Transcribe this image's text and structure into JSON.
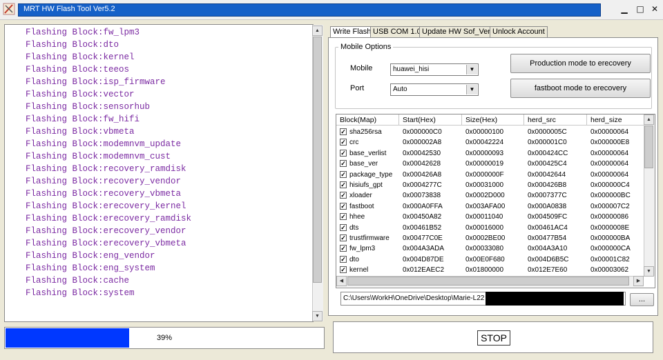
{
  "window": {
    "title": "MRT HW Flash Tool Ver5.2",
    "minimize_icon": "minimize-icon",
    "maximize_icon": "maximize-icon",
    "close_icon": "close-icon"
  },
  "log": {
    "lines": [
      "Flashing Block:fw_lpm3",
      "Flashing Block:dto",
      "Flashing Block:kernel",
      "Flashing Block:teeos",
      "Flashing Block:isp_firmware",
      "Flashing Block:vector",
      "Flashing Block:sensorhub",
      "Flashing Block:fw_hifi",
      "Flashing Block:vbmeta",
      "Flashing Block:modemnvm_update",
      "Flashing Block:modemnvm_cust",
      "Flashing Block:recovery_ramdisk",
      "Flashing Block:recovery_vendor",
      "Flashing Block:recovery_vbmeta",
      "Flashing Block:erecovery_kernel",
      "Flashing Block:erecovery_ramdisk",
      "Flashing Block:erecovery_vendor",
      "Flashing Block:erecovery_vbmeta",
      "Flashing Block:eng_vendor",
      "Flashing Block:eng_system",
      "Flashing Block:cache",
      "Flashing Block:system"
    ],
    "text_color": "#7b2aa2"
  },
  "progress": {
    "value": 0.39,
    "label": "39%",
    "fill_color": "#0038ff"
  },
  "tabs": [
    {
      "label": "Write Flash",
      "active": true
    },
    {
      "label": "USB COM 1.0",
      "active": false
    },
    {
      "label": "Update HW Sof_Ver",
      "active": false
    },
    {
      "label": "Unlock Account",
      "active": false
    }
  ],
  "mobile_options": {
    "group_title": "Mobile Options",
    "mobile_label": "Mobile",
    "mobile_value": "huawei_hisi",
    "port_label": "Port",
    "port_value": "Auto",
    "production_button": "Production mode to erecovery",
    "fastboot_button": "fastboot mode to erecovery"
  },
  "grid": {
    "columns": [
      "Block(Map)",
      "Start(Hex)",
      "Size(Hex)",
      "herd_src",
      "herd_size"
    ],
    "rows": [
      [
        "sha256rsa",
        "0x000000C0",
        "0x00000100",
        "0x0000005C",
        "0x00000064"
      ],
      [
        "crc",
        "0x000002A8",
        "0x00042224",
        "0x000001C0",
        "0x000000E8"
      ],
      [
        "base_verlist",
        "0x00042530",
        "0x00000093",
        "0x000424CC",
        "0x00000064"
      ],
      [
        "base_ver",
        "0x00042628",
        "0x00000019",
        "0x000425C4",
        "0x00000064"
      ],
      [
        "package_type",
        "0x000426A8",
        "0x0000000F",
        "0x00042644",
        "0x00000064"
      ],
      [
        "hisiufs_gpt",
        "0x0004277C",
        "0x00031000",
        "0x000426B8",
        "0x000000C4"
      ],
      [
        "xloader",
        "0x00073838",
        "0x0002D000",
        "0x0007377C",
        "0x000000BC"
      ],
      [
        "fastboot",
        "0x000A0FFA",
        "0x003AFA00",
        "0x000A0838",
        "0x000007C2"
      ],
      [
        "hhee",
        "0x00450A82",
        "0x00011040",
        "0x004509FC",
        "0x00000086"
      ],
      [
        "dts",
        "0x00461B52",
        "0x00016000",
        "0x00461AC4",
        "0x0000008E"
      ],
      [
        "trustfirmware",
        "0x00477C0E",
        "0x0002BE00",
        "0x00477B54",
        "0x000000BA"
      ],
      [
        "fw_lpm3",
        "0x004A3ADA",
        "0x00033080",
        "0x004A3A10",
        "0x000000CA"
      ],
      [
        "dto",
        "0x004D87DE",
        "0x00E0F680",
        "0x004D6B5C",
        "0x00001C82"
      ],
      [
        "kernel",
        "0x012EAEC2",
        "0x01800000",
        "0x012E7E60",
        "0x00003062"
      ]
    ]
  },
  "path": {
    "value": "C:\\Users\\WorkH\\OneDrive\\Desktop\\Marie-L22",
    "browse_label": "..."
  },
  "stop_button": "STOP"
}
